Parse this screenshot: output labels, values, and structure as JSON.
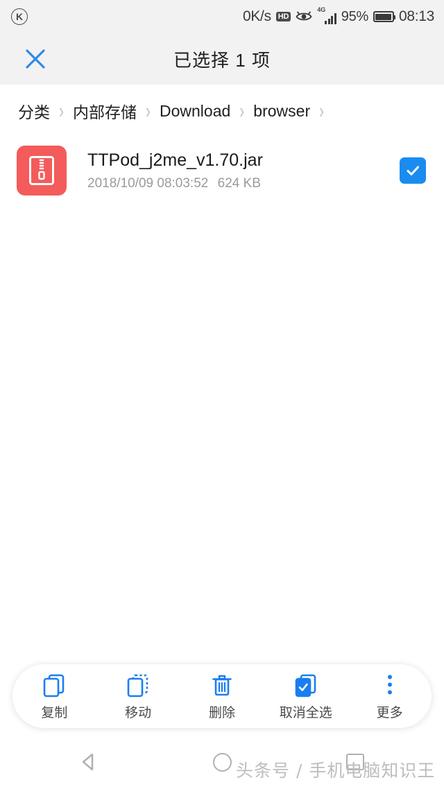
{
  "statusbar": {
    "app_badge": "K",
    "network_speed": "0K/s",
    "hd_badge": "HD",
    "eye_icon": "eye-icon",
    "network_gen": "4G",
    "battery_percent": "95%",
    "time": "08:13"
  },
  "header": {
    "close_icon": "close-icon",
    "title": "已选择 1 项"
  },
  "breadcrumb": {
    "separator": "›",
    "items": [
      {
        "label": "分类"
      },
      {
        "label": "内部存储"
      },
      {
        "label": "Download"
      },
      {
        "label": "browser"
      }
    ]
  },
  "filelist": {
    "rows": [
      {
        "icon": "archive-zip-icon",
        "icon_color": "#f45b5b",
        "name": "TTPod_j2me_v1.70.jar",
        "modified": "2018/10/09 08:03:52",
        "size": "624 KB",
        "selected": true
      }
    ]
  },
  "toolbar": {
    "accent_color": "#1a7ef0",
    "items": [
      {
        "icon": "copy-icon",
        "label": "复制"
      },
      {
        "icon": "move-icon",
        "label": "移动"
      },
      {
        "icon": "delete-icon",
        "label": "删除"
      },
      {
        "icon": "deselect-all-icon",
        "label": "取消全选"
      },
      {
        "icon": "more-icon",
        "label": "更多"
      }
    ]
  },
  "navbar": {
    "back_icon": "back-triangle-icon",
    "home_icon": "home-circle-icon",
    "recents_icon": "recents-square-icon"
  },
  "watermark": {
    "text": "头条号 / 手机电脑知识王"
  }
}
